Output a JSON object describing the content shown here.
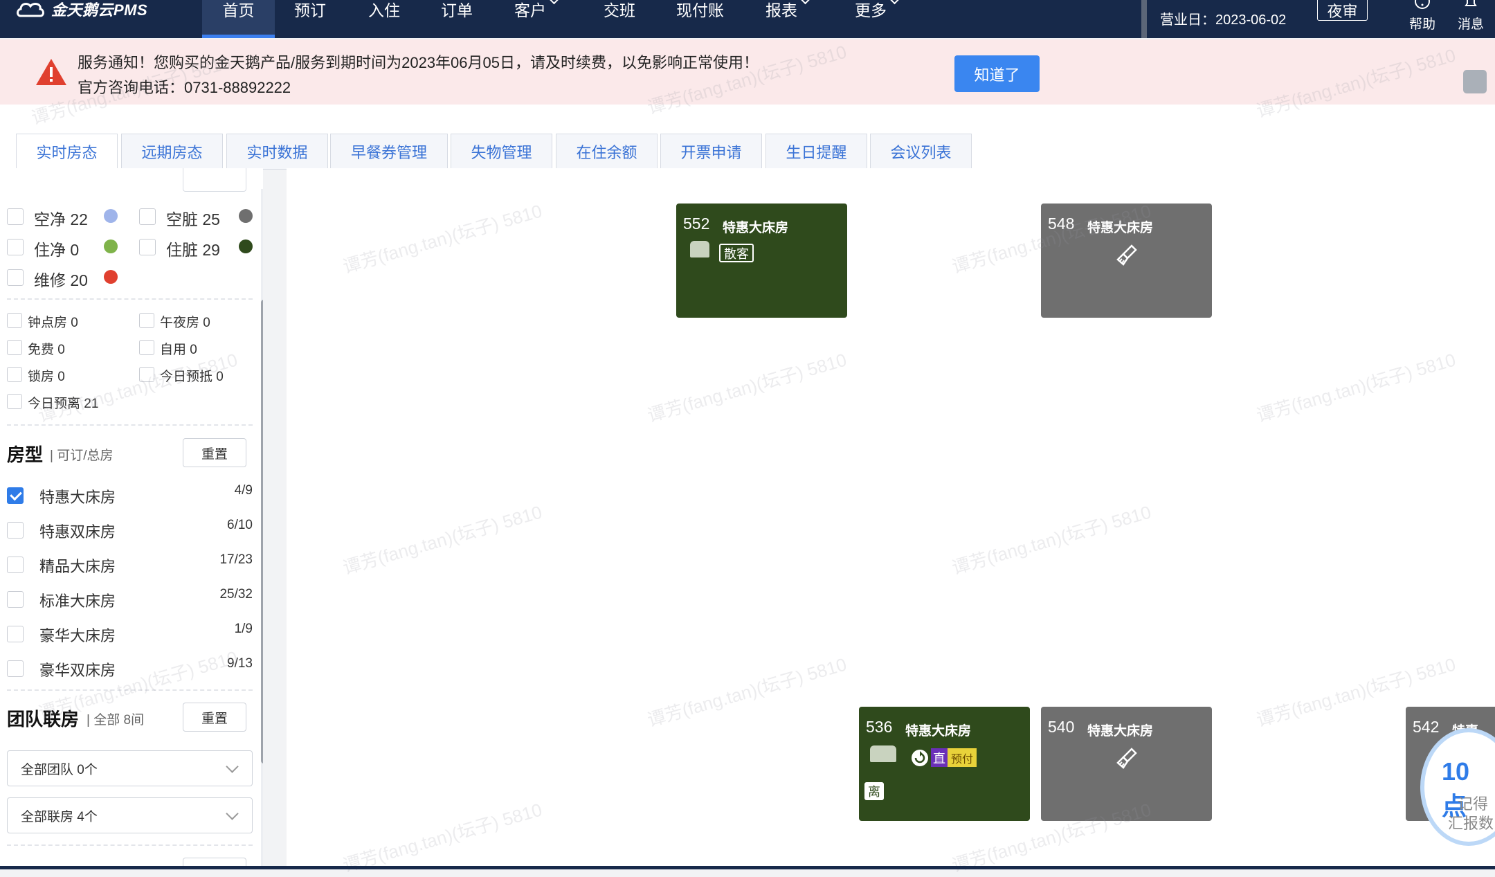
{
  "app": {
    "logo_text": "金天鹅云PMS"
  },
  "nav": {
    "items": [
      {
        "label": "首页",
        "active": true,
        "dropdown": false
      },
      {
        "label": "预订",
        "dropdown": false
      },
      {
        "label": "入住",
        "dropdown": false
      },
      {
        "label": "订单",
        "dropdown": false
      },
      {
        "label": "客户",
        "dropdown": true
      },
      {
        "label": "交班",
        "dropdown": false
      },
      {
        "label": "现付账",
        "dropdown": false
      },
      {
        "label": "报表",
        "dropdown": true
      },
      {
        "label": "更多",
        "dropdown": true
      }
    ],
    "business_date": "营业日：2023-06-02",
    "night_audit": "夜审",
    "help": "帮助",
    "messages": "消息"
  },
  "notice": {
    "line1": "服务通知！您购买的金天鹅产品/服务到期时间为2023年06月05日，请及时续费，以免影响正常使用！",
    "line2": "官方咨询电话：0731-88892222",
    "ok_button": "知道了"
  },
  "tabs": [
    {
      "label": "实时房态",
      "active": true
    },
    {
      "label": "远期房态"
    },
    {
      "label": "实时数据"
    },
    {
      "label": "早餐券管理"
    },
    {
      "label": "失物管理"
    },
    {
      "label": "在住余额"
    },
    {
      "label": "开票申请"
    },
    {
      "label": "生日提醒"
    },
    {
      "label": "会议列表"
    }
  ],
  "room_status": [
    {
      "label": "空净 22",
      "color": "#9fb4ea"
    },
    {
      "label": "空脏 25",
      "color": "#6f6f6f"
    },
    {
      "label": "住净 0",
      "color": "#7fb34a"
    },
    {
      "label": "住脏 29",
      "color": "#2f4a1c"
    },
    {
      "label": "维修 20",
      "color": "#e0402f"
    }
  ],
  "room_flags": [
    "钟点房 0",
    "午夜房 0",
    "免费 0",
    "自用 0",
    "锁房 0",
    "今日预抵 0",
    "今日预离 21"
  ],
  "room_type_section": {
    "title": "房型",
    "subtitle": "可订/总房",
    "reset": "重置",
    "items": [
      {
        "label": "特惠大床房",
        "count": "4/9",
        "checked": true
      },
      {
        "label": "特惠双床房",
        "count": "6/10",
        "checked": false
      },
      {
        "label": "精品大床房",
        "count": "17/23",
        "checked": false
      },
      {
        "label": "标准大床房",
        "count": "25/32",
        "checked": false
      },
      {
        "label": "豪华大床房",
        "count": "1/9",
        "checked": false
      },
      {
        "label": "豪华双床房",
        "count": "9/13",
        "checked": false
      }
    ]
  },
  "group_section": {
    "title": "团队联房",
    "subtitle": "全部 8间",
    "reset": "重置",
    "team_select": "全部团队 0个",
    "link_select": "全部联房 4个"
  },
  "rooms": [
    {
      "number": "552",
      "type": "特惠大床房",
      "status": "occupied-dirty",
      "tag": "散客"
    },
    {
      "number": "548",
      "type": "特惠大床房",
      "status": "vacant-dirty"
    },
    {
      "number": "536",
      "type": "特惠大床房",
      "status": "occupied-dirty",
      "tag_direct": "直",
      "tag_prepaid": "预付",
      "tag_leave": "离"
    },
    {
      "number": "540",
      "type": "特惠大床房",
      "status": "vacant-dirty"
    },
    {
      "number": "542",
      "type": "特惠",
      "status": "vacant-dirty"
    }
  ],
  "promo": {
    "big": "10 点",
    "line1": "记得",
    "line2": "汇报数"
  },
  "watermark": "谭芳(fang.tan)(坛子) 5810"
}
